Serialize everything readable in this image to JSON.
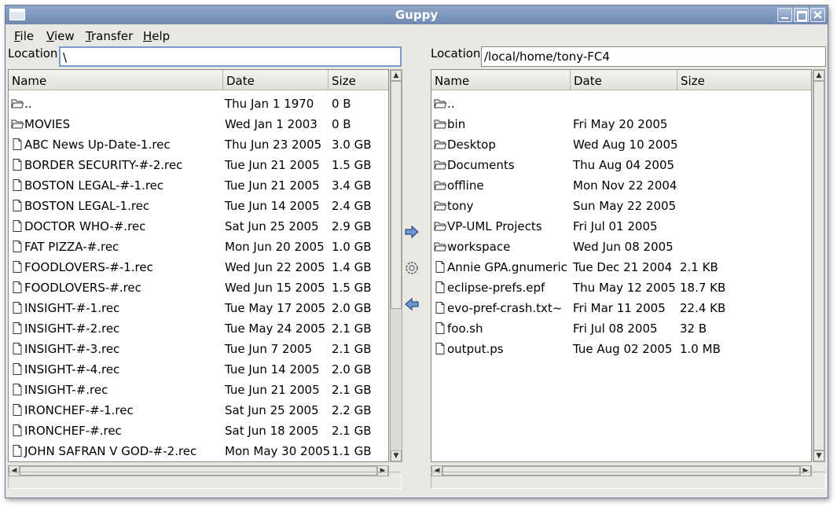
{
  "window": {
    "title": "Guppy"
  },
  "menubar": [
    {
      "key": "F",
      "rest": "ile"
    },
    {
      "key": "V",
      "rest": "iew"
    },
    {
      "key": "T",
      "rest": "ransfer"
    },
    {
      "key": "H",
      "rest": "elp"
    }
  ],
  "left": {
    "location_label": "Location:",
    "location_value": "\\",
    "columns": [
      "Name",
      "Date",
      "Size"
    ],
    "rows": [
      {
        "icon": "folder-icon",
        "name": "..",
        "date": "Thu Jan 1 1970",
        "size": "0 B"
      },
      {
        "icon": "folder-icon",
        "name": "MOVIES",
        "date": "Wed Jan 1 2003",
        "size": "0 B"
      },
      {
        "icon": "file-icon",
        "name": "ABC News Up-Date-1.rec",
        "date": "Thu Jun 23 2005",
        "size": "3.0 GB"
      },
      {
        "icon": "file-icon",
        "name": "BORDER SECURITY-#-2.rec",
        "date": "Tue Jun 21 2005",
        "size": "1.5 GB"
      },
      {
        "icon": "file-icon",
        "name": "BOSTON LEGAL-#-1.rec",
        "date": "Tue Jun 21 2005",
        "size": "3.4 GB"
      },
      {
        "icon": "file-icon",
        "name": "BOSTON LEGAL-1.rec",
        "date": "Tue Jun 14 2005",
        "size": "2.4 GB"
      },
      {
        "icon": "file-icon",
        "name": "DOCTOR WHO-#.rec",
        "date": "Sat Jun 25 2005",
        "size": "2.9 GB"
      },
      {
        "icon": "file-icon",
        "name": "FAT PIZZA-#.rec",
        "date": "Mon Jun 20 2005",
        "size": "1.0 GB"
      },
      {
        "icon": "file-icon",
        "name": "FOODLOVERS-#-1.rec",
        "date": "Wed Jun 22 2005",
        "size": "1.4 GB"
      },
      {
        "icon": "file-icon",
        "name": "FOODLOVERS-#.rec",
        "date": "Wed Jun 15 2005",
        "size": "1.5 GB"
      },
      {
        "icon": "file-icon",
        "name": "INSIGHT-#-1.rec",
        "date": "Tue May 17 2005",
        "size": "2.0 GB"
      },
      {
        "icon": "file-icon",
        "name": "INSIGHT-#-2.rec",
        "date": "Tue May 24 2005",
        "size": "2.1 GB"
      },
      {
        "icon": "file-icon",
        "name": "INSIGHT-#-3.rec",
        "date": "Tue Jun 7 2005",
        "size": "2.1 GB"
      },
      {
        "icon": "file-icon",
        "name": "INSIGHT-#-4.rec",
        "date": "Tue Jun 14 2005",
        "size": "2.0 GB"
      },
      {
        "icon": "file-icon",
        "name": "INSIGHT-#.rec",
        "date": "Tue Jun 21 2005",
        "size": "2.1 GB"
      },
      {
        "icon": "file-icon",
        "name": "IRONCHEF-#-1.rec",
        "date": "Sat Jun 25 2005",
        "size": "2.2 GB"
      },
      {
        "icon": "file-icon",
        "name": "IRONCHEF-#.rec",
        "date": "Sat Jun 18 2005",
        "size": "2.1 GB"
      },
      {
        "icon": "file-icon",
        "name": "JOHN SAFRAN V GOD-#-2.rec",
        "date": "Mon May 30 2005",
        "size": "1.1 GB"
      }
    ]
  },
  "right": {
    "location_label": "Location:",
    "location_value": "/local/home/tony-FC4",
    "columns": [
      "Name",
      "Date",
      "Size"
    ],
    "rows": [
      {
        "icon": "folder-icon",
        "name": "..",
        "date": "",
        "size": ""
      },
      {
        "icon": "folder-icon",
        "name": "bin",
        "date": "Fri May 20 2005",
        "size": ""
      },
      {
        "icon": "folder-icon",
        "name": "Desktop",
        "date": "Wed Aug 10 2005",
        "size": ""
      },
      {
        "icon": "folder-icon",
        "name": "Documents",
        "date": "Thu Aug 04 2005",
        "size": ""
      },
      {
        "icon": "folder-icon",
        "name": "offline",
        "date": "Mon Nov 22 2004",
        "size": ""
      },
      {
        "icon": "folder-icon",
        "name": "tony",
        "date": "Sun May 22 2005",
        "size": ""
      },
      {
        "icon": "folder-icon",
        "name": "VP-UML Projects",
        "date": "Fri Jul 01 2005",
        "size": ""
      },
      {
        "icon": "folder-icon",
        "name": "workspace",
        "date": "Wed Jun 08 2005",
        "size": ""
      },
      {
        "icon": "file-icon",
        "name": "Annie GPA.gnumeric",
        "date": "Tue Dec 21 2004",
        "size": "2.1 KB"
      },
      {
        "icon": "file-icon",
        "name": "eclipse-prefs.epf",
        "date": "Thu May 12 2005",
        "size": "18.7 KB"
      },
      {
        "icon": "file-icon",
        "name": "evo-pref-crash.txt~",
        "date": "Fri Mar 11 2005",
        "size": "22.4 KB"
      },
      {
        "icon": "file-icon",
        "name": "foo.sh",
        "date": "Fri Jul 08 2005",
        "size": "32 B"
      },
      {
        "icon": "file-icon",
        "name": "output.ps",
        "date": "Tue Aug 02 2005",
        "size": "1.0 MB"
      }
    ]
  },
  "transfer": {
    "upload_icon": "arrow-right-icon",
    "refresh_icon": "gear-icon",
    "download_icon": "arrow-left-icon"
  }
}
